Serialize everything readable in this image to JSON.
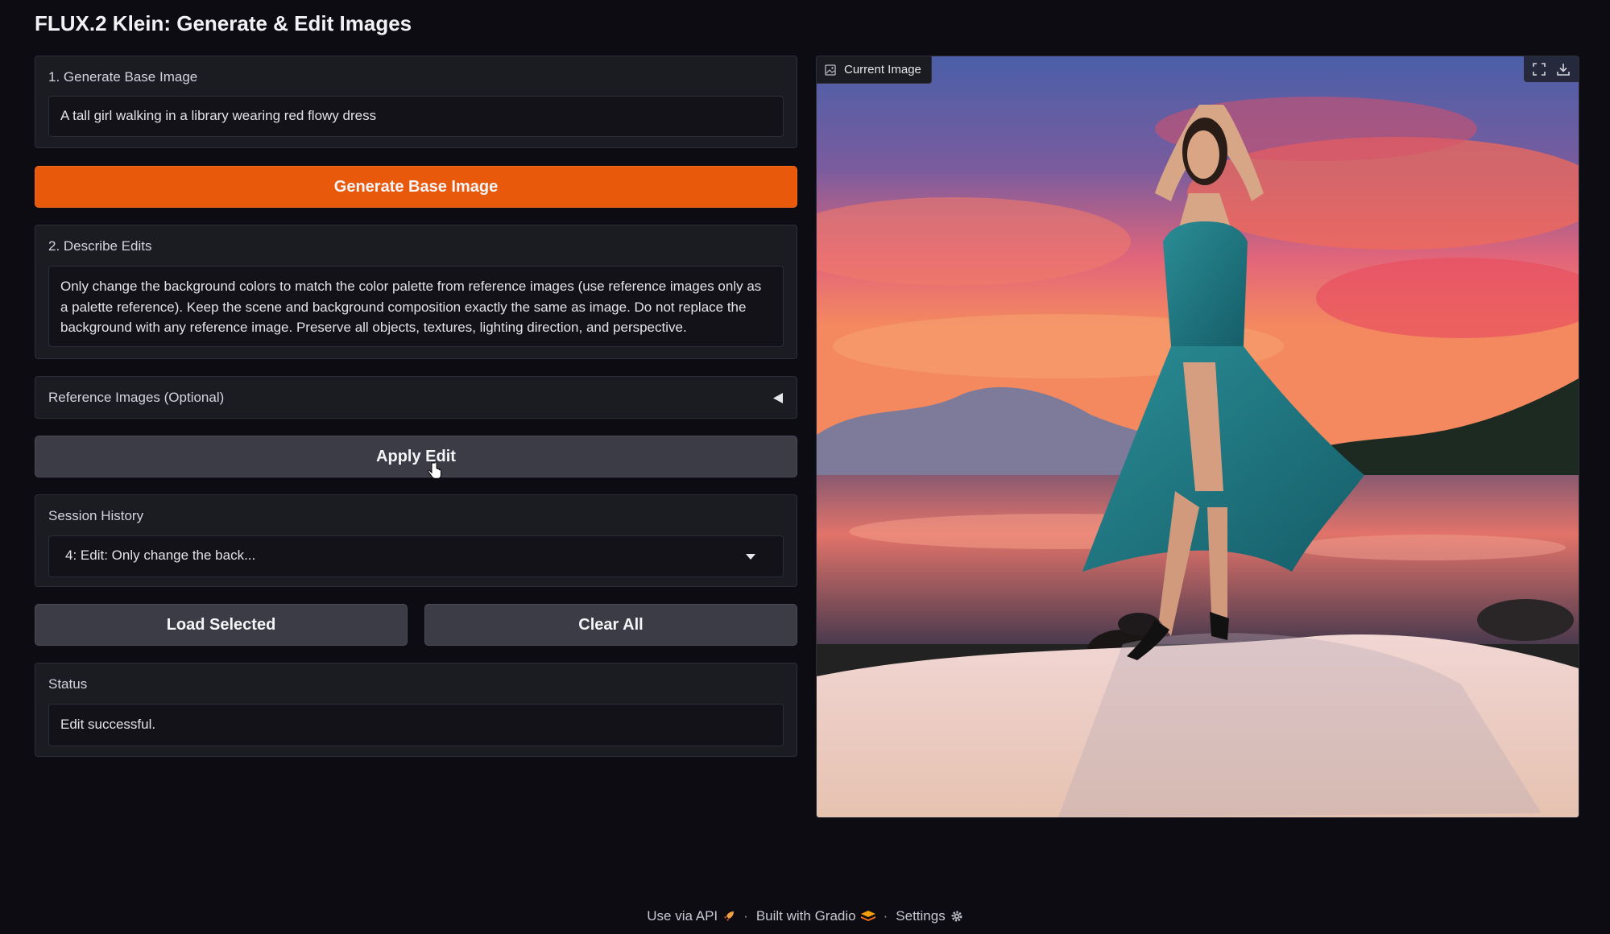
{
  "app": {
    "title": "FLUX.2 Klein: Generate & Edit Images"
  },
  "generate": {
    "label": "1. Generate Base Image",
    "prompt": "A tall girl walking in a library wearing red flowy dress",
    "button": "Generate Base Image"
  },
  "edits": {
    "label": "2. Describe Edits",
    "text": "Only change the background colors to match the color palette from  reference images (use  reference images only as a palette reference). Keep the scene and background composition exactly the same as image. Do not replace the background with any reference image.  Preserve all objects, textures, lighting direction, and perspective."
  },
  "reference": {
    "label": "Reference Images (Optional)",
    "toggle_icon": "triangle-left-icon"
  },
  "apply": {
    "button": "Apply Edit"
  },
  "history": {
    "label": "Session History",
    "selected": "4: Edit: Only change the back...",
    "load_button": "Load Selected",
    "clear_button": "Clear All"
  },
  "status": {
    "label": "Status",
    "value": "Edit successful."
  },
  "image": {
    "label": "Current Image"
  },
  "footer": {
    "api": "Use via API",
    "built": "Built with Gradio",
    "settings": "Settings",
    "separator": "·"
  },
  "colors": {
    "accent": "#e8590c",
    "background": "#0c0c12",
    "panel": "#1b1b22"
  }
}
